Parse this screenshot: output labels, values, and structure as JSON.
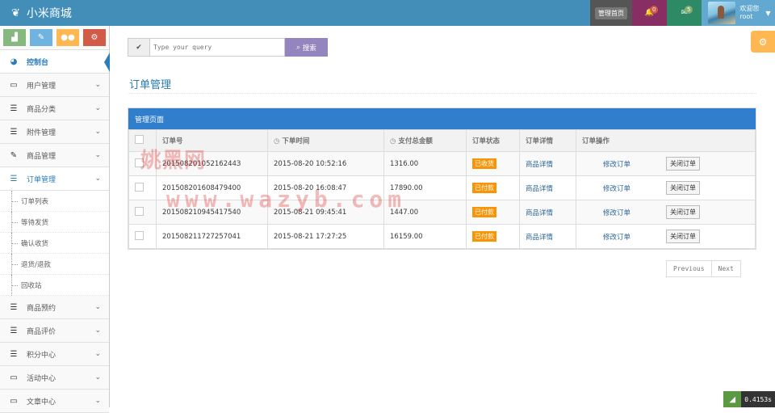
{
  "brand": {
    "title": "小米商城"
  },
  "navbar": {
    "home_label": "管理首页",
    "bell_count": "0",
    "mail_count": "5",
    "welcome": "欢迎您",
    "username": "root"
  },
  "sidebar": {
    "items": [
      {
        "label": "控制台",
        "icon": "dashboard-icon"
      },
      {
        "label": "用户管理",
        "icon": "desktop-icon"
      },
      {
        "label": "商品分类",
        "icon": "list-icon"
      },
      {
        "label": "附件管理",
        "icon": "list-icon"
      },
      {
        "label": "商品管理",
        "icon": "edit-icon"
      },
      {
        "label": "订单管理",
        "icon": "list-icon"
      },
      {
        "label": "商品预约",
        "icon": "list-icon"
      },
      {
        "label": "商品评价",
        "icon": "list-icon"
      },
      {
        "label": "积分中心",
        "icon": "list-icon"
      },
      {
        "label": "活动中心",
        "icon": "desktop-icon"
      },
      {
        "label": "文章中心",
        "icon": "desktop-icon"
      }
    ],
    "order_sub": [
      "订单列表",
      "等待发货",
      "确认收货",
      "退货/退款",
      "回收站"
    ]
  },
  "search": {
    "placeholder": "Type your query",
    "button": "搜索"
  },
  "page": {
    "title": "订单管理",
    "panel_title": "管理页面"
  },
  "table": {
    "headers": [
      "订单号",
      "下单时间",
      "支付总金额",
      "订单状态",
      "订单详情",
      "订单操作"
    ],
    "rows": [
      {
        "id": "20150820105216244З",
        "time": "2015-08-20 10:52:16",
        "amount": "1316.00",
        "status": "已收货",
        "detail": "商品详情",
        "edit": "修改订单",
        "close": "关闭订单"
      },
      {
        "id": "201508201608479400",
        "time": "2015-08-20 16:08:47",
        "amount": "17890.00",
        "status": "已付款",
        "detail": "商品详情",
        "edit": "修改订单",
        "close": "关闭订单"
      },
      {
        "id": "201508210945417540",
        "time": "2015-08-21 09:45:41",
        "amount": "1447.00",
        "status": "已付款",
        "detail": "商品详情",
        "edit": "修改订单",
        "close": "关闭订单"
      },
      {
        "id": "201508211727257041",
        "time": "2015-08-21 17:27:25",
        "amount": "16159.00",
        "status": "已付款",
        "detail": "商品详情",
        "edit": "修改订单",
        "close": "关闭订单"
      }
    ]
  },
  "pager": {
    "prev": "Previous",
    "next": "Next"
  },
  "watermark": {
    "line1": "姚黑网",
    "line2": "www.wazyb.com"
  },
  "timer": {
    "value": "0.4153s"
  }
}
